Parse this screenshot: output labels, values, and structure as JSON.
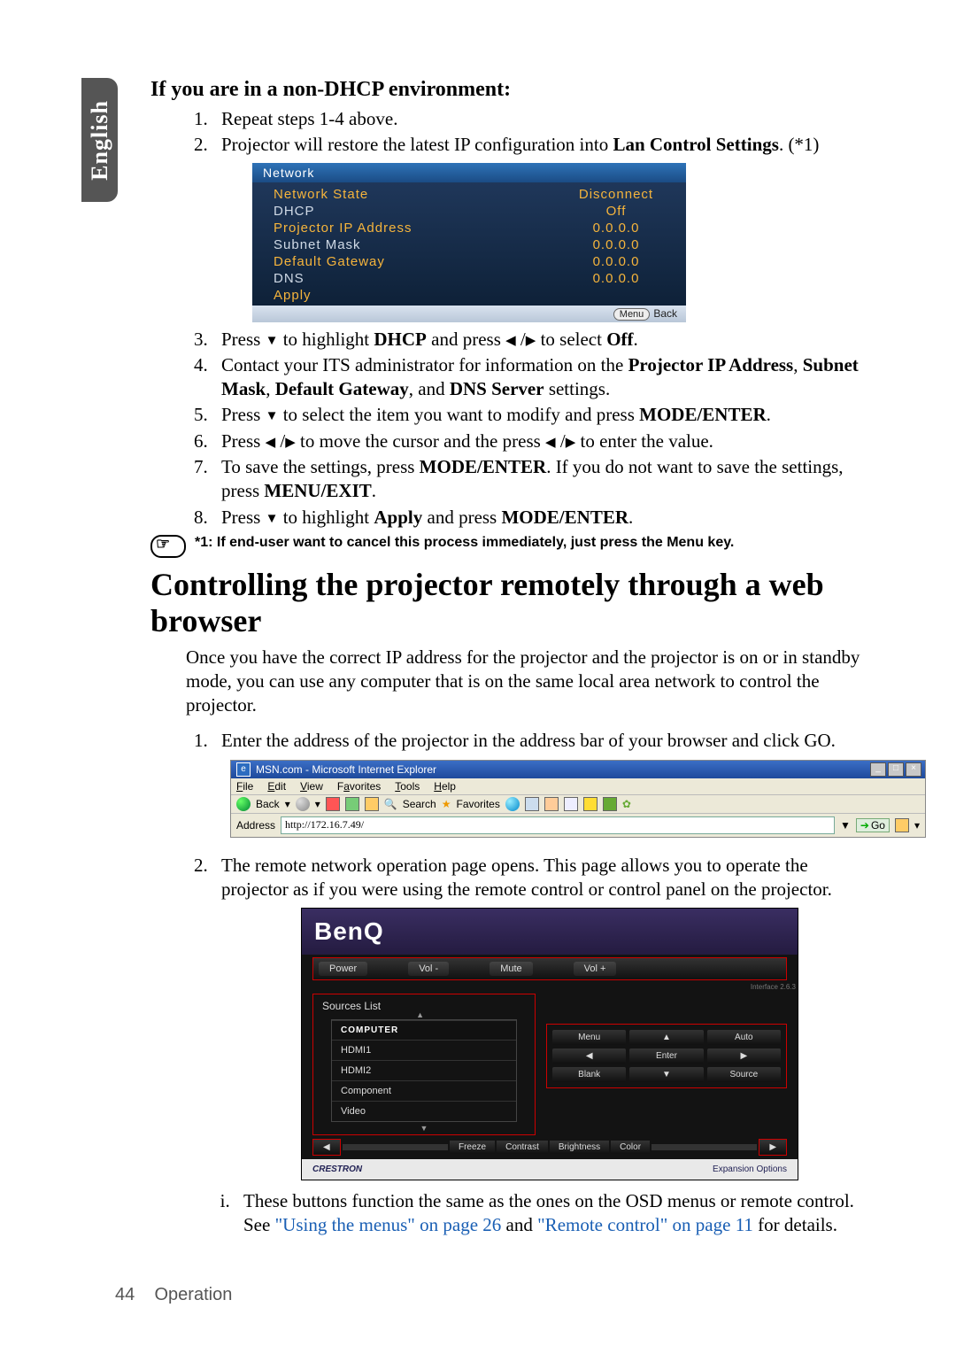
{
  "side_tab": "English",
  "section_heading": "If you are in a non-DHCP environment:",
  "list_a": {
    "i1": "Repeat steps 1-4 above.",
    "i2_a": "Projector will restore the latest IP configuration into ",
    "i2_b": "Lan Control Settings",
    "i2_c": ". (*1)"
  },
  "osd": {
    "title": "Network",
    "rows": [
      {
        "label": "Network State",
        "value": "Disconnect"
      },
      {
        "label": "DHCP",
        "value": "Off"
      },
      {
        "label": "Projector IP Address",
        "value": "0.0.0.0"
      },
      {
        "label": "Subnet Mask",
        "value": "0.0.0.0"
      },
      {
        "label": "Default Gateway",
        "value": "0.0.0.0"
      },
      {
        "label": "DNS",
        "value": "0.0.0.0"
      },
      {
        "label": "Apply",
        "value": ""
      }
    ],
    "foot_btn": "Menu",
    "foot_label": "Back"
  },
  "list_b": {
    "i3_a": "Press ",
    "i3_b": " to highlight ",
    "i3_c": "DHCP",
    "i3_d": " and press ",
    "i3_e": " to select ",
    "i3_f": "Off",
    "i4_a": "Contact your ITS administrator for information on the ",
    "i4_b": "Projector IP Address",
    "i4_c": ", ",
    "i4_d": "Subnet Mask",
    "i4_e": ", ",
    "i4_f": "Default Gateway",
    "i4_g": ", and ",
    "i4_h": "DNS Server",
    "i4_i": " settings.",
    "i5_a": "Press ",
    "i5_b": " to select the item you want to modify and press ",
    "i5_c": "MODE/ENTER",
    "i6_a": "Press ",
    "i6_b": " to move the cursor and the press ",
    "i6_c": " to enter the value.",
    "i7_a": "To save the settings, press ",
    "i7_b": "MODE/ENTER",
    "i7_c": ". If you do not want to save the settings, press ",
    "i7_d": "MENU/EXIT",
    "i8_a": "Press ",
    "i8_b": " to highlight ",
    "i8_c": "Apply",
    "i8_d": " and press ",
    "i8_e": "MODE/ENTER"
  },
  "note_text": "*1: If end-user want to cancel this process immediately, just press the Menu key.",
  "main_heading": "Controlling the projector remotely through a web browser",
  "intro": "Once you have the correct IP address for the projector and the projector is on or in standby mode, you can use any computer that is on the same local area network to control the projector.",
  "list_c": {
    "i1": "Enter the address of the projector in the address bar of your browser and click GO.",
    "i2": "The remote network operation page opens. This page allows you to operate the projector as if you were using the remote control or control panel on the projector."
  },
  "ie": {
    "title": "MSN.com - Microsoft Internet Explorer",
    "menus": [
      "File",
      "Edit",
      "View",
      "Favorites",
      "Tools",
      "Help"
    ],
    "back": "Back",
    "search": "Search",
    "fav": "Favorites",
    "addr_label": "Address",
    "addr_value": "http://172.16.7.49/",
    "go": "Go"
  },
  "benq": {
    "logo": "BenQ",
    "top": [
      "Power",
      "Vol -",
      "Mute",
      "Vol +"
    ],
    "iface": "Interface 2.6.3",
    "sources_title": "Sources List",
    "sources": [
      "COMPUTER",
      "HDMI1",
      "HDMI2",
      "Component",
      "Video"
    ],
    "pad": [
      "Menu",
      "▲",
      "Auto",
      "◀",
      "Enter",
      "▶",
      "Blank",
      "▼",
      "Source"
    ],
    "bar": [
      "Freeze",
      "Contrast",
      "Brightness",
      "Color"
    ],
    "crestron": "CRESTRON",
    "exp": "Expansion Options"
  },
  "roman": {
    "i_a": "These buttons function the same as the ones on the OSD menus or remote control. See ",
    "i_link1": "\"Using the menus\" on page 26",
    "i_and": " and ",
    "i_link2": "\"Remote control\" on page 11",
    "i_end": " for details."
  },
  "footer_page": "44",
  "footer_section": "Operation"
}
